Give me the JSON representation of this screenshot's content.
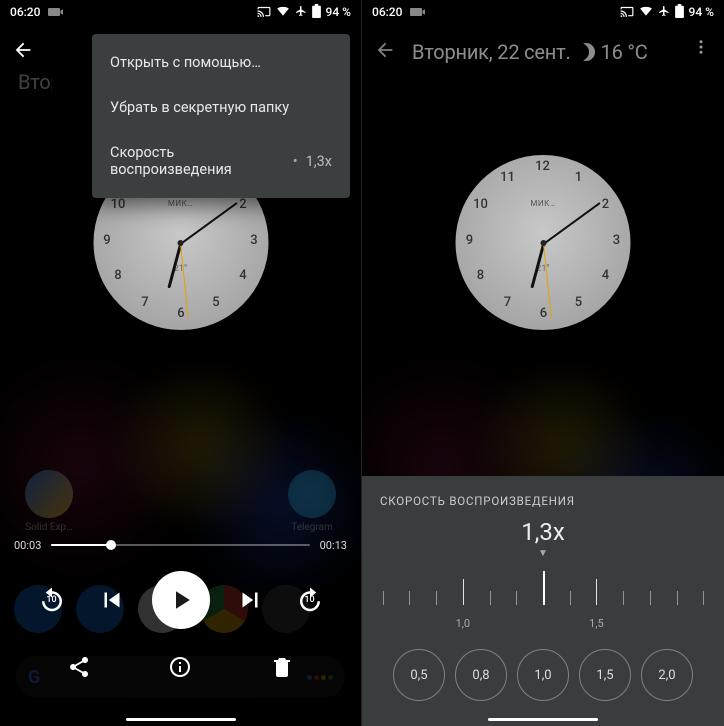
{
  "status": {
    "time": "06:20",
    "battery": "94 %"
  },
  "date_line": {
    "text": "Вторник, 22 сент.",
    "temp": "16 °C"
  },
  "clock": {
    "mini_label": "МИК…",
    "temp_label": "21°"
  },
  "menu": {
    "open_with": "Открыть с помощью…",
    "move_secret": "Убрать в секретную папку",
    "playback_speed_label": "Скорость воспроизведения",
    "playback_speed_value": "1,3x"
  },
  "video": {
    "elapsed": "00:03",
    "duration": "00:13",
    "rewind_amount": "10",
    "forward_amount": "10"
  },
  "apps": {
    "solid": "Solid Exp…",
    "telegram": "Telegram"
  },
  "speed_panel": {
    "title": "СКОРОСТЬ ВОСПРОИЗВЕДЕНИЯ",
    "current": "1,3x",
    "label_a": "1,0",
    "label_b": "1,5",
    "chips": [
      "0,5",
      "0,8",
      "1,0",
      "1,5",
      "2,0"
    ]
  }
}
